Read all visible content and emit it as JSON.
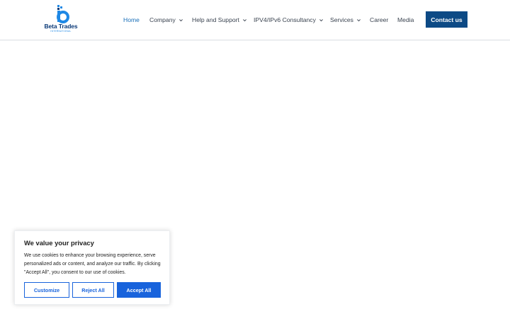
{
  "brand": {
    "name": "Beta Trades",
    "tagline": "INTERNATIONAL",
    "primary_color": "#0b3a78",
    "accent_color": "#1e88e5"
  },
  "nav": {
    "items": [
      {
        "label": "Home",
        "active": true,
        "has_dropdown": false
      },
      {
        "label": "Company",
        "active": false,
        "has_dropdown": true
      },
      {
        "label": "Help and Support",
        "active": false,
        "has_dropdown": true
      },
      {
        "label": "IPV4/IPv6 Consultancy",
        "active": false,
        "has_dropdown": true
      },
      {
        "label": "Services",
        "active": false,
        "has_dropdown": true
      },
      {
        "label": "Career",
        "active": false,
        "has_dropdown": false
      },
      {
        "label": "Media",
        "active": false,
        "has_dropdown": false
      }
    ],
    "cta_label": "Contact us",
    "cta_color": "#0d4a85"
  },
  "cookie_banner": {
    "title": "We value your privacy",
    "text": "We use cookies to enhance your browsing experience, serve personalized ads or content, and analyze our traffic. By clicking \"Accept All\", you consent to our use of cookies.",
    "customize_label": "Customize",
    "reject_label": "Reject All",
    "accept_label": "Accept All",
    "button_color": "#1863dc"
  }
}
